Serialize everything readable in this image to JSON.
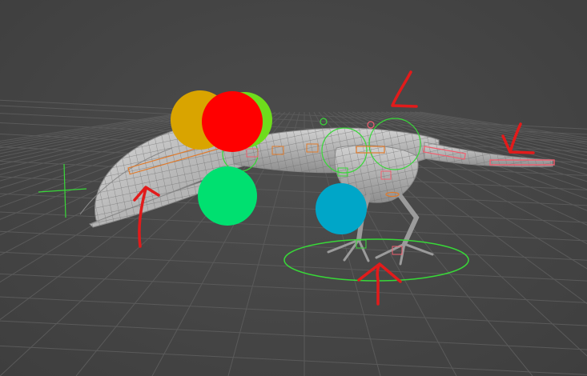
{
  "viewport": {
    "background": "#444444",
    "grid_color": "#5a5a5a",
    "model_color": "#b9b9b9",
    "wire_color": "#7e7e7e",
    "annotation_color": "#e21b1b",
    "controls": {
      "head_gold": "#d9a400",
      "head_red": "#ff0000",
      "head_green": "#6edc1c",
      "jaw_green": "#00e070",
      "chest_cyan": "#00a6c8",
      "rig_green": "#38d838",
      "rig_orange": "#e07a2a",
      "rig_pink": "#f06070"
    }
  }
}
